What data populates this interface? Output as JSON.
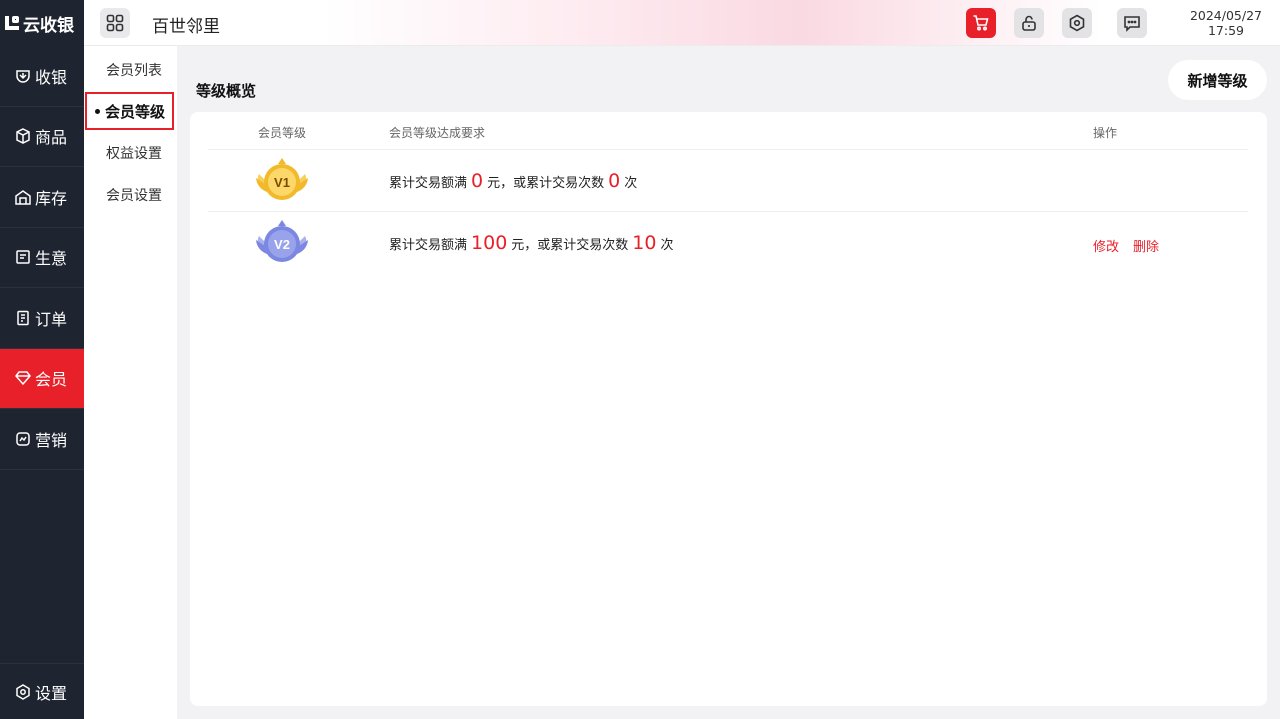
{
  "app": {
    "logo_text": "云收银",
    "store_name": "百世邻里"
  },
  "header": {
    "date": "2024/05/27",
    "time": "17:59"
  },
  "nav": {
    "items": [
      {
        "label": "收银",
        "icon": "cashier-icon"
      },
      {
        "label": "商品",
        "icon": "box-icon"
      },
      {
        "label": "库存",
        "icon": "warehouse-icon"
      },
      {
        "label": "生意",
        "icon": "report-icon"
      },
      {
        "label": "订单",
        "icon": "order-icon"
      },
      {
        "label": "会员",
        "icon": "diamond-icon"
      },
      {
        "label": "营销",
        "icon": "marketing-icon"
      }
    ],
    "active": "会员",
    "settings_label": "设置"
  },
  "subnav": {
    "items": [
      {
        "label": "会员列表"
      },
      {
        "label": "会员等级"
      },
      {
        "label": "权益设置"
      },
      {
        "label": "会员设置"
      }
    ],
    "active": "会员等级"
  },
  "main": {
    "section_title": "等级概览",
    "add_button": "新增等级",
    "columns": {
      "level": "会员等级",
      "requirement": "会员等级达成要求",
      "action": "操作"
    },
    "levels": [
      {
        "badge": "V1",
        "badge_color": "#f2b92b",
        "req_prefix": "累计交易额满",
        "amount": "0",
        "amount_unit": "元，或累计交易次数",
        "count": "0",
        "count_unit": "次",
        "actions": []
      },
      {
        "badge": "V2",
        "badge_color": "#7b87e0",
        "req_prefix": "累计交易额满",
        "amount": "100",
        "amount_unit": "元，或累计交易次数",
        "count": "10",
        "count_unit": "次",
        "actions": [
          "修改",
          "删除"
        ]
      }
    ]
  },
  "colors": {
    "accent": "#e8202a",
    "sidebar_bg": "#1f2530"
  }
}
